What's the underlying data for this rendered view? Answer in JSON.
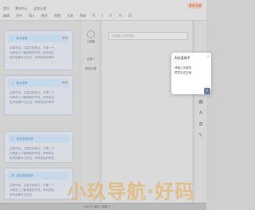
{
  "menubar": {
    "row1": [
      "首页",
      "素材中心",
      "全部分类"
    ],
    "row2": [
      "编辑",
      "文件",
      "插入",
      "格式",
      "视图",
      "工具",
      "帮助"
    ],
    "toolbar_icons": [
      "bold-icon",
      "italic-icon",
      "underline-icon",
      "align-icon",
      "list-icon",
      "link-icon"
    ],
    "badge": "登录/注册"
  },
  "leftpane": {
    "cards": [
      {
        "index": "一",
        "title": "重点段落",
        "body": [
          "这类内容，注重文段表达，只是一个",
          "为概念入门做铺垫的环境，所有前后",
          "的内容都可以在这，所有前后的联系",
          "这就是个"
        ]
      },
      {
        "index": "二",
        "title": "重点段落",
        "body": [
          "这类内容，注重文段表达，只是一个",
          "为概念入门做铺垫的环境，所有前后",
          "的内容都可以在这，所有前后的联系",
          "这就是个"
        ]
      },
      {
        "index": "三",
        "title": "重点段落标题",
        "body": [
          "这类内容，注重文段表达，只是一个",
          "为概念入门做铺垫的环境，所有前后",
          "的内容都可以在这，所有前后的联系"
        ]
      },
      {
        "index": "四",
        "title": "重点段落标题",
        "body": [
          "这类内容，注重文段表达，只是一个",
          "为概念入门做铺垫的环境，所有前后",
          "的内容都可以在这"
        ]
      }
    ]
  },
  "midcol": {
    "avatar_label": "主题稿",
    "side_item_1": "主题 1",
    "side_item_2": "新建主题"
  },
  "editor": {
    "search_placeholder": "在此输入文本内容"
  },
  "popup": {
    "title": "AI文案助手",
    "text": [
      "请输入关键词",
      "帮您生成文案。"
    ],
    "close": "×",
    "ok": "✓"
  },
  "footer": {
    "text": "Ctrl+S 保存 | 字数 0"
  },
  "watermark": {
    "text": "小玖导航·好码"
  },
  "colors": {
    "accent": "#6a8fb1",
    "link": "#d07a4a",
    "badge": "#b25a3a"
  }
}
